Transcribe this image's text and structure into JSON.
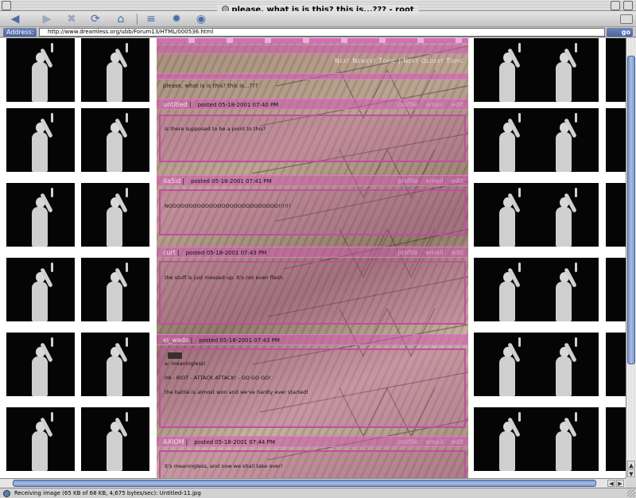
{
  "window": {
    "title": "please, what is is this? this is...??? - root"
  },
  "toolbar": {
    "buttons": [
      {
        "name": "back",
        "glyph": "◀",
        "enabled": true
      },
      {
        "name": "forward",
        "glyph": "▶",
        "enabled": false
      },
      {
        "name": "stop",
        "glyph": "✖",
        "enabled": false
      },
      {
        "name": "refresh",
        "glyph": "⟳",
        "enabled": true
      },
      {
        "name": "home",
        "glyph": "⌂",
        "enabled": true
      },
      {
        "name": "favorites",
        "glyph": "≡",
        "enabled": true
      },
      {
        "name": "history",
        "glyph": "✹",
        "enabled": true
      },
      {
        "name": "search",
        "glyph": "◉",
        "enabled": true
      }
    ]
  },
  "address": {
    "label": "Address:",
    "url": "http://www.dreamless.org/ubb/Forum13/HTML/000536.html",
    "go": "go"
  },
  "forum": {
    "nav_topics": "Next Newest Topic | Next Oldest Topic",
    "thread_title": "please, what is is this? this is...???",
    "posts": [
      {
        "author": "untitled",
        "posted": "posted 05-18-2001 07:40 PM",
        "text": "is there supposed to be a point to this?",
        "tools": [
          "profile",
          "email",
          "edit"
        ]
      },
      {
        "author": "da5id",
        "posted": "posted 05-18-2001 07:41 PM",
        "text": "NOOOOOOOOOOOOOOOOOOOOOOOOOOO!!!!!!",
        "tools": [
          "profile",
          "email",
          "edit"
        ]
      },
      {
        "author": "curt",
        "posted": "posted 05-18-2001 07:43 PM",
        "text": "the stuff is just messed up. It's not even flash.",
        "tools": [
          "profile",
          "email",
          "edit"
        ]
      },
      {
        "author": "el_wado",
        "posted": "posted 05-18-2001 07:43 PM",
        "text": "a: meaningless!\n\n08 - RIOT - ATTACK ATTACK! - GO GO GO!\n\nthe battle is almost won and we've hardly ever started!",
        "tools": [
          "profile",
          "email",
          "edit"
        ]
      },
      {
        "author": "AXIOM",
        "posted": "posted 05-18-2001 07:44 PM",
        "text": "It's meaningless, and now we shall take over!",
        "tools": [
          "profile",
          "email",
          "edit"
        ]
      }
    ]
  },
  "status": {
    "text": "Receiving image (65 KB of 68 KB, 4,675 bytes/sec): Untitled-11.jpg"
  },
  "colors": {
    "accent_blue": "#4b6ea8",
    "forum_pink": "#c54aa8",
    "tile_background": "#050505"
  }
}
